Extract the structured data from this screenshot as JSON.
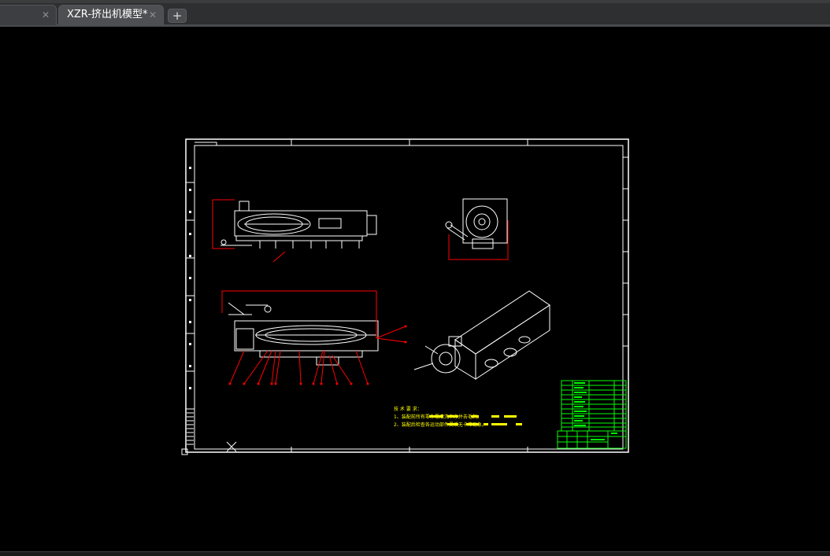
{
  "tabs": [
    {
      "label": "",
      "close": "✕"
    },
    {
      "label": "XZR-挤出机模型*",
      "close": "✕"
    }
  ],
  "new_tab_label": "+",
  "drawing": {
    "notes_lines": [
      "技 术 要 求：",
      "1、装配前所有零件需清洗干净并去毛刺。",
      "2、装配后检查各运动部件灵活无卡滞现象。"
    ],
    "colors": {
      "frame": "#ffffff",
      "dimension": "#ff0000",
      "notes": "#ffff00",
      "title_block": "#00ff00",
      "background": "#000000"
    }
  }
}
